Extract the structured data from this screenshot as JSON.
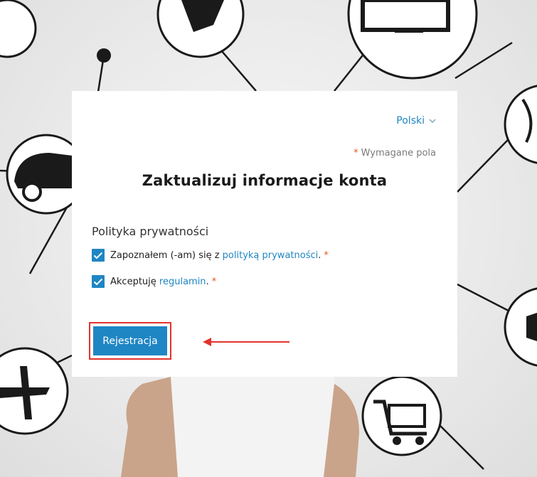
{
  "language": {
    "selected": "Polski",
    "chevron_icon": "chevron-down-icon"
  },
  "required_note": {
    "star": "*",
    "text": "Wymagane pola"
  },
  "title": "Zaktualizuj informacje konta",
  "privacy": {
    "section_title": "Polityka prywatności",
    "items": [
      {
        "prefix": "Zapoznałem (-am) się z ",
        "link": "polityką prywatności",
        "suffix": ".",
        "star": "*",
        "checked": true
      },
      {
        "prefix": "Akceptuję ",
        "link": "regulamin",
        "suffix": ".",
        "star": "*",
        "checked": true
      }
    ]
  },
  "submit_label": "Rejestracja",
  "colors": {
    "accent": "#1f86c4",
    "required": "#e05a1e",
    "highlight": "#e3332d"
  }
}
